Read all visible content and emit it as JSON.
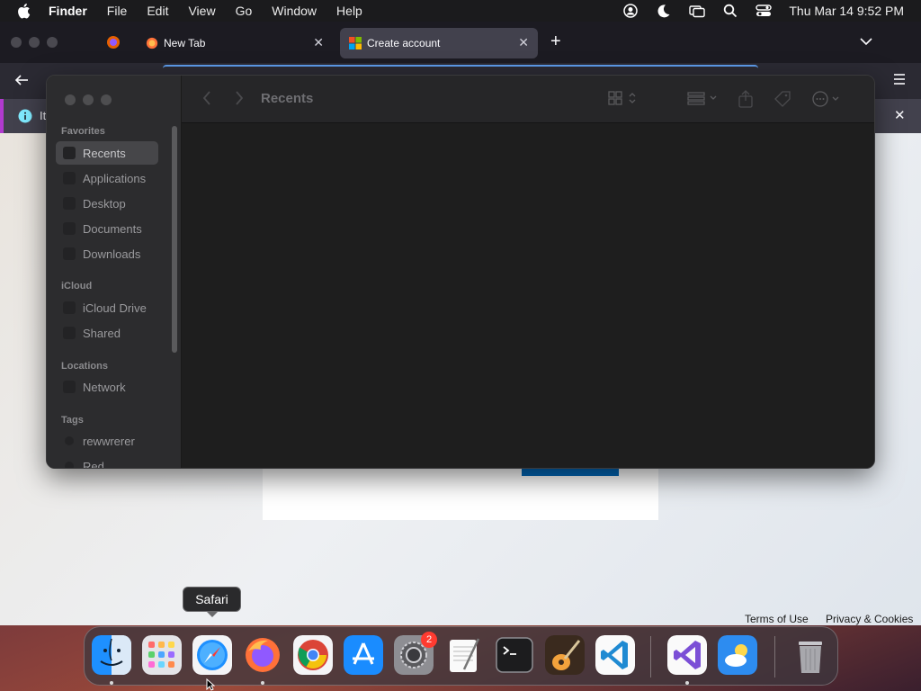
{
  "menubar": {
    "app_name": "Finder",
    "menus": [
      "File",
      "Edit",
      "View",
      "Go",
      "Window",
      "Help"
    ],
    "clock": "Thu Mar 14  9:52 PM"
  },
  "browser": {
    "tabs": [
      {
        "label": "New Tab"
      },
      {
        "label": "Create account"
      }
    ],
    "infobar_text": "It",
    "footer": {
      "terms": "Terms of Use",
      "privacy": "Privacy & Cookies"
    }
  },
  "finder": {
    "title": "Recents",
    "sidebar": {
      "favorites_header": "Favorites",
      "favorites": [
        "Recents",
        "Applications",
        "Desktop",
        "Documents",
        "Downloads"
      ],
      "icloud_header": "iCloud",
      "icloud": [
        "iCloud Drive",
        "Shared"
      ],
      "locations_header": "Locations",
      "locations": [
        "Network"
      ],
      "tags_header": "Tags",
      "tags": [
        "rewwrerer",
        "Red"
      ]
    }
  },
  "tooltip": "Safari",
  "dock": {
    "apps": [
      "Finder",
      "Launchpad",
      "Safari",
      "Firefox",
      "Chrome",
      "App Store",
      "System Settings",
      "TextEdit",
      "Terminal",
      "GarageBand",
      "Visual Studio Code",
      "Visual Studio",
      "Weather",
      "Trash"
    ],
    "settings_badge": "2"
  }
}
